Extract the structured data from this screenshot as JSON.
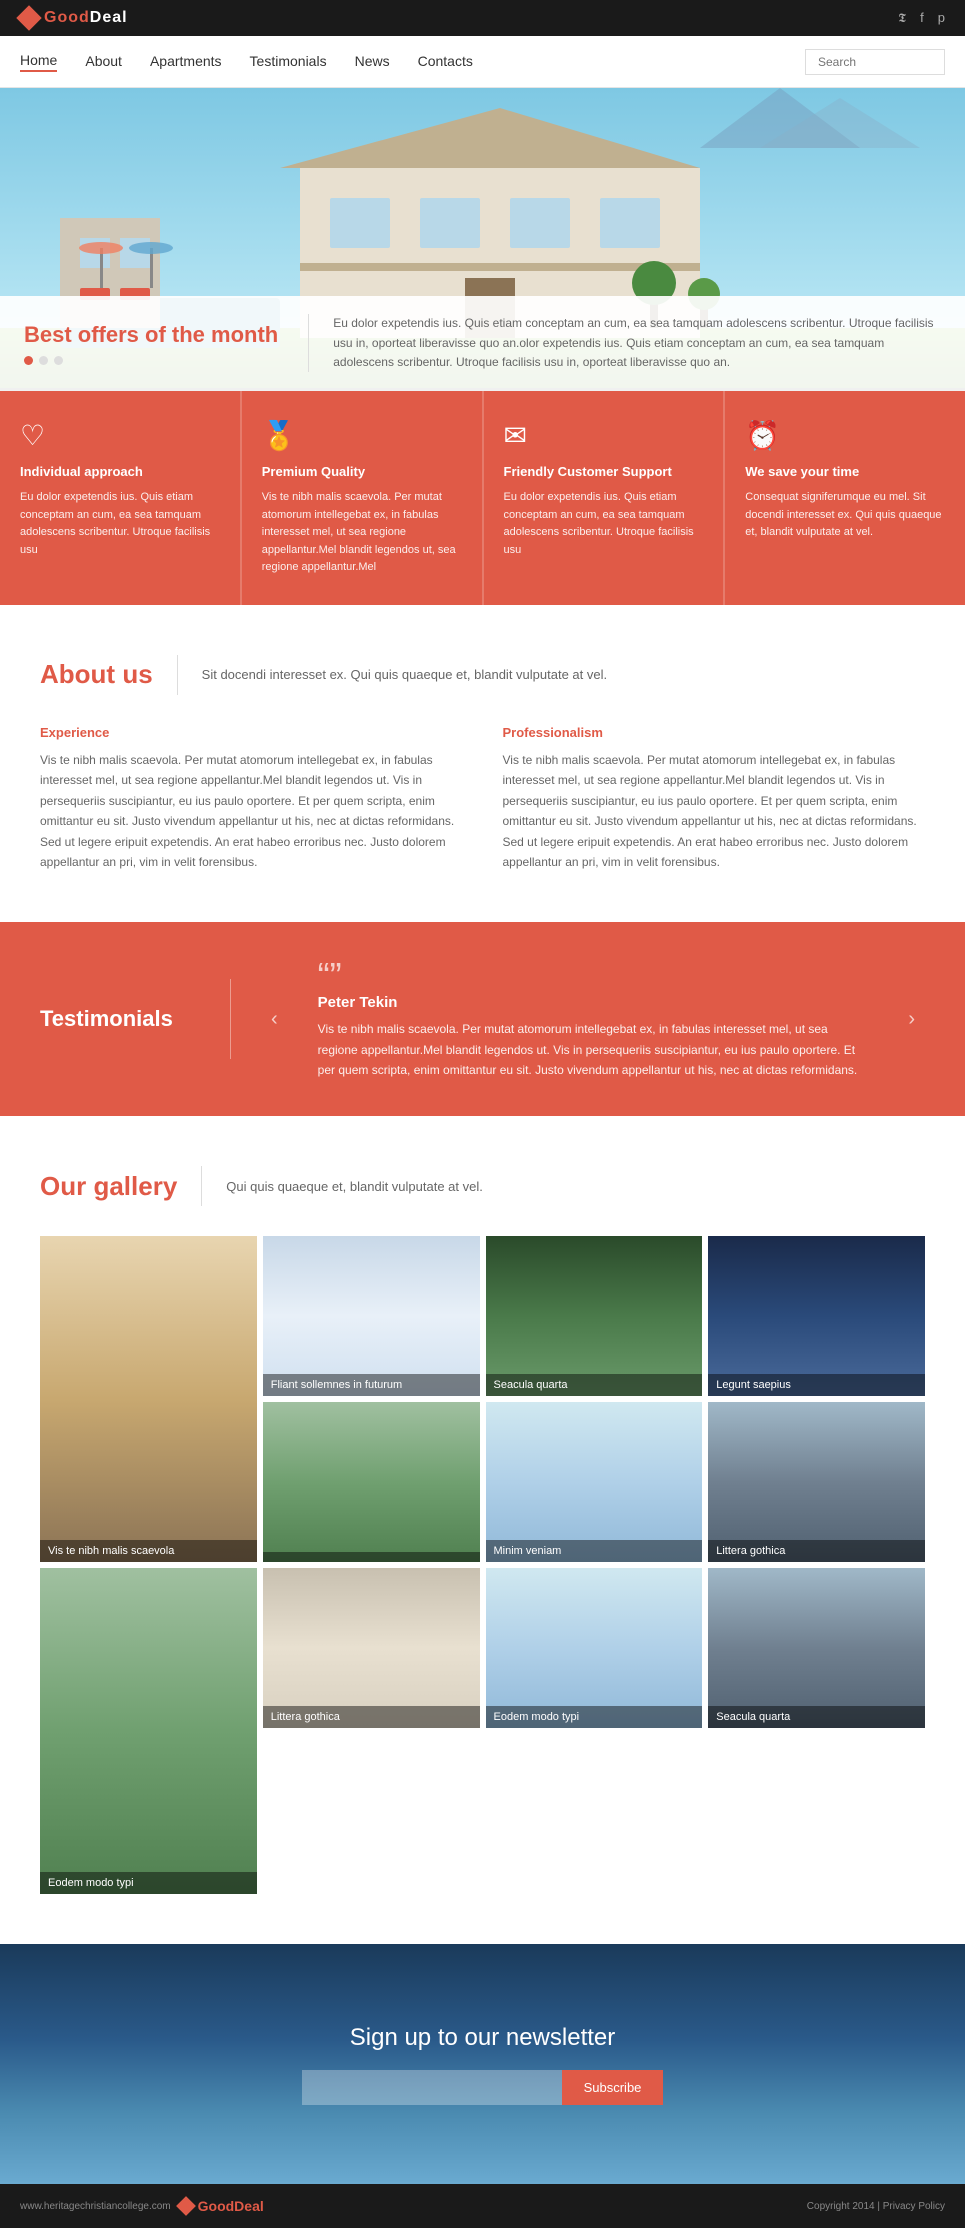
{
  "brand": {
    "name_part1": "Good",
    "name_part2": "Deal",
    "logo_icon": "diamond"
  },
  "social": {
    "twitter": "𝕿",
    "facebook": "f",
    "pinterest": "p"
  },
  "nav": {
    "links": [
      {
        "label": "Home",
        "active": true
      },
      {
        "label": "About",
        "active": false
      },
      {
        "label": "Apartments",
        "active": false
      },
      {
        "label": "Testimonials",
        "active": false
      },
      {
        "label": "News",
        "active": false
      },
      {
        "label": "Contacts",
        "active": false
      }
    ],
    "search_placeholder": "Search"
  },
  "hero": {
    "title": "Best offers",
    "title_suffix": " of the month",
    "description": "Eu dolor expetendis ius. Quis etiam conceptam an cum, ea sea tamquam adolescens scribentur. Utroque facilisis usu in, oporteat liberavisse quo an.olor expetendis ius. Quis etiam conceptam an cum, ea sea tamquam adolescens scribentur. Utroque facilisis usu in, oporteat liberavisse quo an.",
    "dots": [
      true,
      false,
      false
    ]
  },
  "features": [
    {
      "icon": "♡",
      "title": "Individual approach",
      "desc": "Eu dolor expetendis ius. Quis etiam conceptam an cum, ea sea tamquam adolescens scribentur. Utroque facilisis usu"
    },
    {
      "icon": "★",
      "title": "Premium Quality",
      "desc": "Vis te nibh malis scaevola. Per mutat atomorum intellegebat ex, in fabulas interesset mel, ut sea regione appellantur.Mel blandit legendos ut, sea regione appellantur.Mel"
    },
    {
      "icon": "✉",
      "title": "Friendly Customer Support",
      "desc": "Eu dolor expetendis ius. Quis etiam conceptam an cum, ea sea tamquam adolescens scribentur. Utroque facilisis usu"
    },
    {
      "icon": "⏰",
      "title": "We save your time",
      "desc": "Consequat signiferumque eu mel. Sit docendi interesset ex. Qui quis quaeque et, blandit vulputate at vel."
    }
  ],
  "about": {
    "title": "About",
    "title_highlight": " us",
    "subtitle": "Sit docendi interesset ex. Qui quis quaeque et, blandit vulputate at vel.",
    "columns": [
      {
        "title": "Experience",
        "text": "Vis te nibh malis scaevola. Per mutat atomorum intellegebat ex, in fabulas interesset mel, ut sea regione appellantur.Mel blandit legendos ut. Vis in persequeriis suscipiantur, eu ius paulo oportere. Et per quem scripta, enim omittantur eu sit. Justo vivendum appellantur ut his, nec at dictas reformidans. Sed ut legere eripuit expetendis. An erat habeo erroribus nec. Justo dolorem appellantur an pri, vim in velit forensibus."
      },
      {
        "title": "Professionalism",
        "text": "Vis te nibh malis scaevola. Per mutat atomorum intellegebat ex, in fabulas interesset mel, ut sea regione appellantur.Mel blandit legendos ut. Vis in persequeriis suscipiantur, eu ius paulo oportere. Et per quem scripta, enim omittantur eu sit. Justo vivendum appellantur ut his, nec at dictas reformidans. Sed ut legere eripuit expetendis. An erat habeo erroribus nec. Justo dolorem appellantur an pri, vim in velit forensibus."
      }
    ]
  },
  "testimonials": {
    "title": "Testimonials",
    "author": "Peter Tekin",
    "text": "Vis te nibh malis scaevola. Per mutat atomorum intellegebat ex, in fabulas interesset mel, ut sea regione appellantur.Mel blandit legendos ut. Vis in persequeriis suscipiantur, eu ius paulo oportere. Et per quem scripta, enim omittantur eu sit. Justo vivendum appellantur ut his, nec at dictas reformidans."
  },
  "gallery": {
    "title": "Our",
    "title_highlight": " gallery",
    "subtitle": "Qui quis quaeque et, blandit vulputate at vel.",
    "items": [
      {
        "label": "Vis te nibh malis scaevola",
        "tall": true,
        "color": "gp1"
      },
      {
        "label": "Fliant sollemnes in futurum",
        "tall": false,
        "color": "gp3"
      },
      {
        "label": "Seacula quarta",
        "tall": false,
        "color": "gp4"
      },
      {
        "label": "Legunt saepius",
        "tall": false,
        "color": "gp2"
      },
      {
        "label": "",
        "tall": false,
        "color": "gp5"
      },
      {
        "label": "Minim veniam",
        "tall": true,
        "color": "gp6"
      },
      {
        "label": "Littera gothica",
        "tall": false,
        "color": "gp7"
      },
      {
        "label": "Eodem modo typi",
        "tall": false,
        "color": "gp5"
      },
      {
        "label": "Seacula quarta",
        "tall": false,
        "color": "gp8"
      }
    ]
  },
  "newsletter": {
    "title": "Sign up to our newsletter",
    "input_placeholder": "",
    "button_label": "Subscribe"
  },
  "footer": {
    "url": "www.heritagechristiancollege.com",
    "brand_part1": "Good",
    "brand_part2": "Deal",
    "copyright": "Copyright 2014  |  Privacy Policy"
  }
}
